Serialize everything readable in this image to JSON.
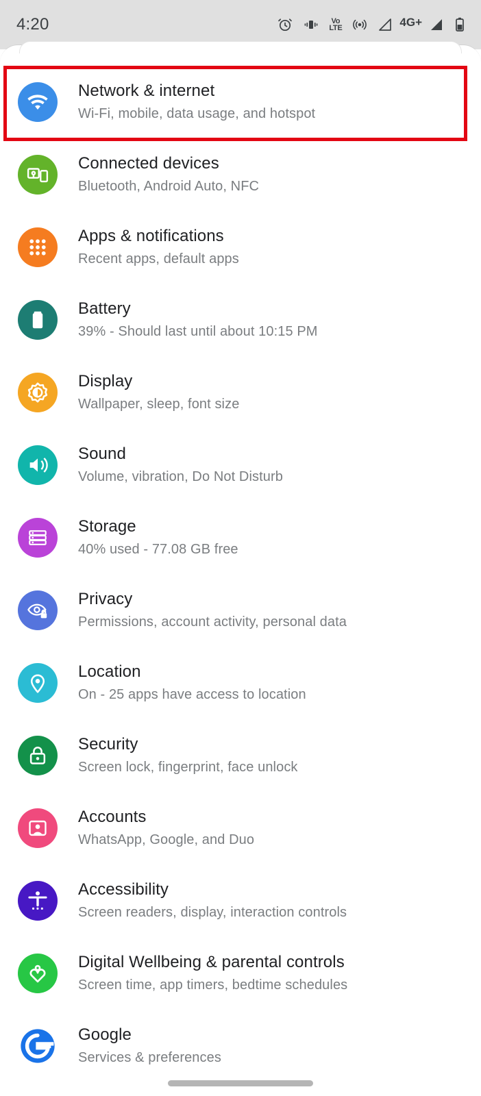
{
  "statusbar": {
    "clock": "4:20",
    "network_label": "4G+",
    "icons": [
      "alarm-icon",
      "vibrate-icon",
      "volte-icon",
      "hotspot-icon",
      "signal-bars-icon",
      "signal-bars-2-icon",
      "battery-icon"
    ],
    "volte_top": "Vo",
    "volte_bottom": "LTE"
  },
  "highlight": {
    "color": "#e30613",
    "target": "Network & internet"
  },
  "settings": {
    "items": [
      {
        "title": "Network & internet",
        "subtitle": "Wi-Fi, mobile, data usage, and hotspot",
        "icon": "wifi-icon",
        "color": "#3b8ee8"
      },
      {
        "title": "Connected devices",
        "subtitle": "Bluetooth, Android Auto, NFC",
        "icon": "devices-icon",
        "color": "#63b32a"
      },
      {
        "title": "Apps & notifications",
        "subtitle": "Recent apps, default apps",
        "icon": "apps-grid-icon",
        "color": "#f57c20"
      },
      {
        "title": "Battery",
        "subtitle": "39% - Should last until about 10:15 PM",
        "icon": "battery-icon",
        "color": "#1d7d73"
      },
      {
        "title": "Display",
        "subtitle": "Wallpaper, sleep, font size",
        "icon": "brightness-icon",
        "color": "#f5a623"
      },
      {
        "title": "Sound",
        "subtitle": "Volume, vibration, Do Not Disturb",
        "icon": "volume-icon",
        "color": "#11b5ab"
      },
      {
        "title": "Storage",
        "subtitle": "40% used - 77.08 GB free",
        "icon": "storage-icon",
        "color": "#ba43d8"
      },
      {
        "title": "Privacy",
        "subtitle": "Permissions, account activity, personal data",
        "icon": "eye-lock-icon",
        "color": "#5574dd"
      },
      {
        "title": "Location",
        "subtitle": "On - 25 apps have access to location",
        "icon": "location-pin-icon",
        "color": "#2bbcd4"
      },
      {
        "title": "Security",
        "subtitle": "Screen lock, fingerprint, face unlock",
        "icon": "lock-icon",
        "color": "#13914a"
      },
      {
        "title": "Accounts",
        "subtitle": "WhatsApp, Google, and Duo",
        "icon": "account-card-icon",
        "color": "#f04a7d"
      },
      {
        "title": "Accessibility",
        "subtitle": "Screen readers, display, interaction controls",
        "icon": "accessibility-icon",
        "color": "#4718c4"
      },
      {
        "title": "Digital Wellbeing & parental controls",
        "subtitle": "Screen time, app timers, bedtime schedules",
        "icon": "wellbeing-heart-icon",
        "color": "#27c745"
      },
      {
        "title": "Google",
        "subtitle": "Services & preferences",
        "icon": "google-g-icon",
        "color": "#1a73e8"
      }
    ]
  },
  "navbar": {
    "pill": "gesture-nav-pill"
  }
}
